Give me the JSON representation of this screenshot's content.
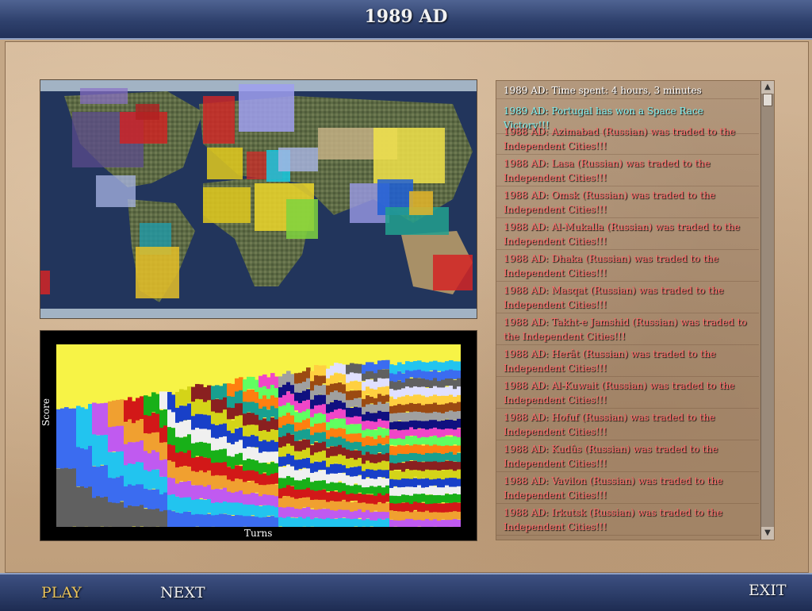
{
  "header": {
    "title": "1989 AD"
  },
  "graph": {
    "ylabel": "Score",
    "xlabel": "Turns"
  },
  "events": [
    {
      "text": "1989 AD: Time spent: 4 hours, 3 minutes",
      "color": "white"
    },
    {
      "text": "1989 AD: Portugal has won a Space Race Victory!!!",
      "color": "cyan"
    },
    {
      "text": "1988 AD: Azimabad (Russian) was traded to the Independent Cities!!!",
      "color": "red"
    },
    {
      "text": "1988 AD: Lasa (Russian) was traded to the Independent Cities!!!",
      "color": "red"
    },
    {
      "text": "1988 AD: Omsk (Russian) was traded to the Independent Cities!!!",
      "color": "red"
    },
    {
      "text": "1988 AD: Al-Mukalla (Russian) was traded to the Independent Cities!!!",
      "color": "red"
    },
    {
      "text": "1988 AD: Dhaka (Russian) was traded to the Independent Cities!!!",
      "color": "red"
    },
    {
      "text": "1988 AD: Masqat (Russian) was traded to the Independent Cities!!!",
      "color": "red"
    },
    {
      "text": "1988 AD: Takht-e Jamshid (Russian) was traded to the Independent Cities!!!",
      "color": "red"
    },
    {
      "text": "1988 AD: Herât (Russian) was traded to the Independent Cities!!!",
      "color": "red"
    },
    {
      "text": "1988 AD: Al-Kuwait (Russian) was traded to the Independent Cities!!!",
      "color": "red"
    },
    {
      "text": "1988 AD: Hofuf (Russian) was traded to the Independent Cities!!!",
      "color": "red"
    },
    {
      "text": "1988 AD: Kudûs (Russian) was traded to the Independent Cities!!!",
      "color": "red"
    },
    {
      "text": "1988 AD: Vavilon (Russian) was traded to the Independent Cities!!!",
      "color": "red"
    },
    {
      "text": "1988 AD: Irkutsk (Russian) was traded to the Independent Cities!!!",
      "color": "red"
    }
  ],
  "buttons": {
    "play": "PLAY",
    "next": "NEXT",
    "exit": "EXIT"
  },
  "colors": {
    "play_label": "#e8c25a",
    "event_white": "#ffffff",
    "event_cyan": "#7ff3f3",
    "event_red": "#ff6a6a",
    "ocean": "#22355c"
  },
  "icons": {
    "scroll_up": "scroll-up-arrow-icon",
    "scroll_down": "scroll-down-arrow-icon"
  }
}
